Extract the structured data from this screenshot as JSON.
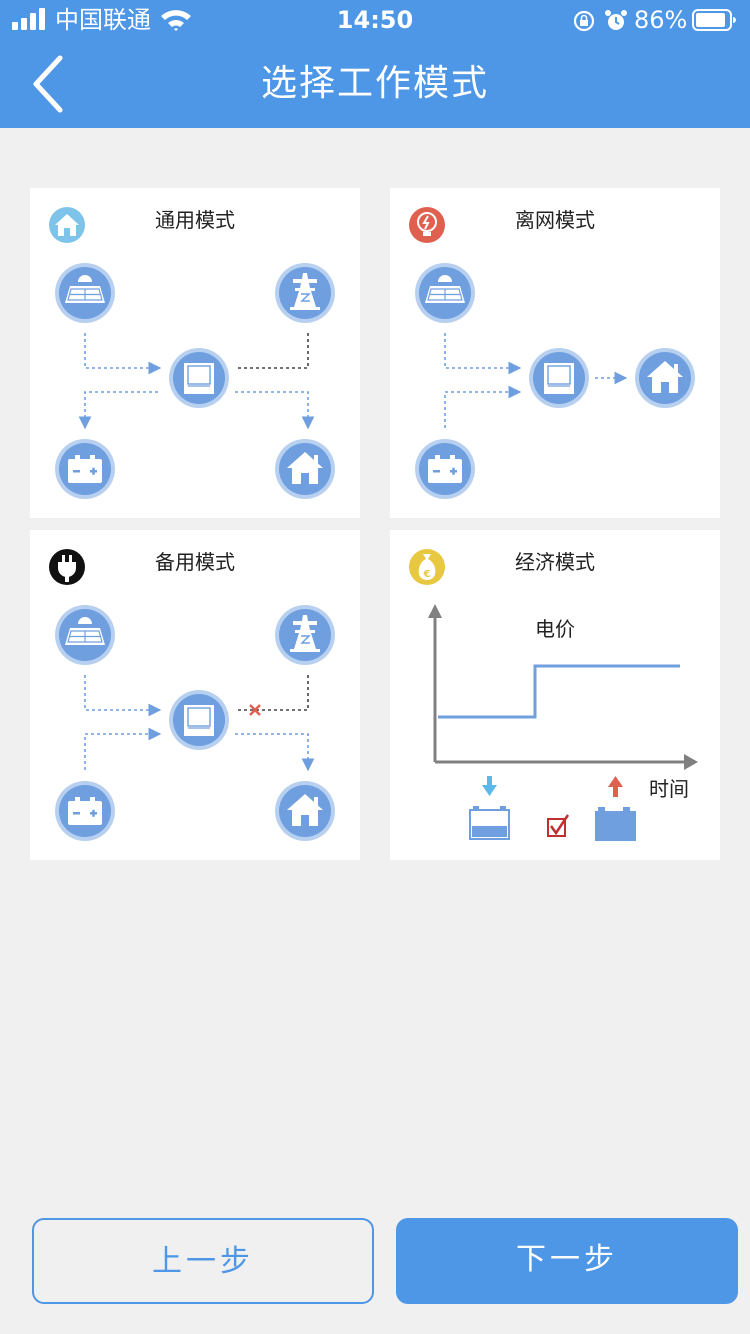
{
  "status_bar": {
    "carrier": "中国联通",
    "time": "14:50",
    "battery_percent": "86%"
  },
  "header": {
    "title": "选择工作模式"
  },
  "modes": [
    {
      "title": "通用模式",
      "icon": "home-icon"
    },
    {
      "title": "离网模式",
      "icon": "bulb-icon"
    },
    {
      "title": "备用模式",
      "icon": "plug-icon"
    },
    {
      "title": "经济模式",
      "icon": "money-bag-icon"
    }
  ],
  "economy_chart": {
    "price_label": "电价",
    "time_label": "时间"
  },
  "footer": {
    "prev_label": "上一步",
    "next_label": "下一步"
  },
  "colors": {
    "primary": "#4e96e6",
    "icon_fill": "#6f9fdf",
    "icon_ring": "#b8d0f0",
    "charge_arrow": "#5bb8e8",
    "discharge_arrow": "#e06050",
    "cross": "#e06050"
  }
}
